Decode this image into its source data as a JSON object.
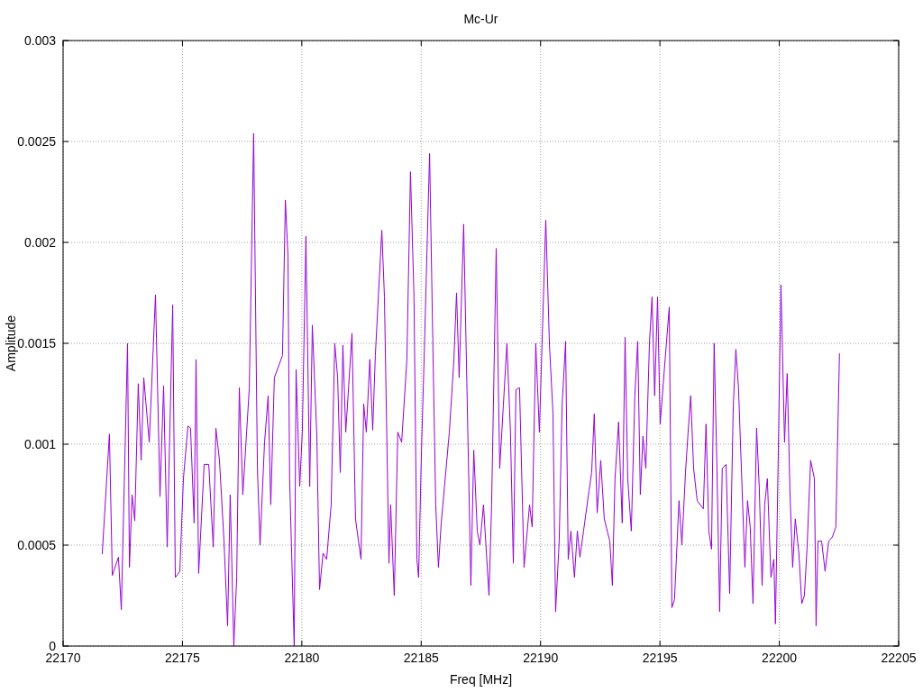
{
  "chart_data": {
    "type": "line",
    "grid": true,
    "title": "Mc-Ur",
    "xlabel": "Freq [MHz]",
    "ylabel": "Amplitude",
    "xlim": [
      22170,
      22205
    ],
    "ylim": [
      0,
      0.003
    ],
    "xticks": [
      22170,
      22175,
      22180,
      22185,
      22190,
      22195,
      22200,
      22205
    ],
    "yticks": [
      0,
      0.0005,
      0.001,
      0.0015,
      0.002,
      0.0025,
      0.003
    ],
    "x": [
      22171.64,
      22171.94,
      22172.06,
      22172.32,
      22172.44,
      22172.7,
      22172.78,
      22172.89,
      22173,
      22173.15,
      22173.27,
      22173.38,
      22173.61,
      22173.87,
      22174.06,
      22174.21,
      22174.36,
      22174.59,
      22174.7,
      22174.89,
      22175.04,
      22175.23,
      22175.34,
      22175.49,
      22175.57,
      22175.68,
      22175.91,
      22176.1,
      22176.29,
      22176.4,
      22176.55,
      22176.74,
      22176.89,
      22177,
      22177.15,
      22177.27,
      22177.38,
      22177.53,
      22177.8,
      22177.98,
      22178.14,
      22178.25,
      22178.44,
      22178.59,
      22178.7,
      22178.85,
      22179.19,
      22179.31,
      22179.42,
      22179.49,
      22179.68,
      22179.76,
      22179.91,
      22180.02,
      22180.17,
      22180.33,
      22180.44,
      22180.63,
      22180.74,
      22180.89,
      22181.04,
      22181.23,
      22181.38,
      22181.5,
      22181.61,
      22181.72,
      22181.84,
      22182.1,
      22182.25,
      22182.48,
      22182.59,
      22182.7,
      22182.85,
      22182.97,
      22183.08,
      22183.35,
      22183.46,
      22183.65,
      22183.72,
      22183.87,
      22184.02,
      22184.18,
      22184.4,
      22184.55,
      22184.7,
      22184.82,
      22184.89,
      22185.01,
      22185.12,
      22185.35,
      22185.5,
      22185.61,
      22185.72,
      22185.84,
      22186.18,
      22186.37,
      22186.48,
      22186.59,
      22186.78,
      22186.93,
      22187.08,
      22187.2,
      22187.35,
      22187.46,
      22187.61,
      22187.84,
      22187.95,
      22188.14,
      22188.29,
      22188.44,
      22188.59,
      22188.74,
      22188.86,
      22188.97,
      22189.12,
      22189.31,
      22189.54,
      22189.65,
      22189.8,
      22189.95,
      22190.22,
      22190.37,
      22190.52,
      22190.63,
      22190.78,
      22190.9,
      22191.05,
      22191.16,
      22191.27,
      22191.42,
      22191.54,
      22191.65,
      22191.8,
      22192.03,
      22192.14,
      22192.25,
      22192.37,
      22192.52,
      22192.67,
      22192.9,
      22193.01,
      22193.12,
      22193.27,
      22193.42,
      22193.54,
      22193.65,
      22193.8,
      22193.95,
      22194.07,
      22194.18,
      22194.29,
      22194.41,
      22194.56,
      22194.67,
      22194.78,
      22194.9,
      22195.01,
      22195.27,
      22195.39,
      22195.5,
      22195.61,
      22195.8,
      22195.92,
      22196.07,
      22196.18,
      22196.29,
      22196.41,
      22196.56,
      22196.82,
      22196.93,
      22197.05,
      22197.16,
      22197.27,
      22197.39,
      22197.5,
      22197.61,
      22197.77,
      22197.92,
      22198.07,
      22198.18,
      22198.29,
      22198.41,
      22198.56,
      22198.67,
      22198.78,
      22198.9,
      22199.05,
      22199.16,
      22199.28,
      22199.39,
      22199.5,
      22199.65,
      22199.77,
      22199.84,
      22199.96,
      22200.07,
      22200.22,
      22200.33,
      22200.45,
      22200.56,
      22200.67,
      22200.82,
      22200.94,
      22201.05,
      22201.16,
      22201.31,
      22201.47,
      22201.54,
      22201.62,
      22201.77,
      22201.92,
      22202.07,
      22202.22,
      22202.37,
      22202.52
    ],
    "series": [
      {
        "color": "#9400d3",
        "values": [
          0.000455,
          0.00105,
          0.00035,
          0.00044,
          0.00018,
          0.0015,
          0.00039,
          0.00075,
          0.00062,
          0.0013,
          0.00092,
          0.00133,
          0.00101,
          0.00174,
          0.00074,
          0.00129,
          0.00049,
          0.00169,
          0.00034,
          0.00037,
          0.00083,
          0.00109,
          0.00108,
          0.00061,
          0.00142,
          0.00036,
          0.0009,
          0.0009,
          0.00049,
          0.00108,
          0.00092,
          0.00052,
          0.0001,
          0.00075,
          0,
          0.00034,
          0.00128,
          0.00075,
          0.00128,
          0.00254,
          0.00088,
          0.0005,
          0.00101,
          0.00124,
          0.0007,
          0.00133,
          0.00144,
          0.00221,
          0.00193,
          0.00083,
          0,
          0.00137,
          0.00079,
          0.00106,
          0.00203,
          0.00079,
          0.00159,
          0.00104,
          0.00028,
          0.00046,
          0.00043,
          0.0007,
          0.0015,
          0.00133,
          0.00086,
          0.00149,
          0.00106,
          0.00155,
          0.00063,
          0.00043,
          0.0012,
          0.00106,
          0.00142,
          0.00107,
          0.00144,
          0.00206,
          0.00173,
          0.00041,
          0.0007,
          0.00025,
          0.00106,
          0.00101,
          0.00142,
          0.00235,
          0.00173,
          0.00043,
          0.00034,
          0.00097,
          0.00142,
          0.00244,
          0.00142,
          0.0007,
          0.00039,
          0.00061,
          0.00106,
          0.00142,
          0.00175,
          0.00133,
          0.00209,
          0.0012,
          0.0003,
          0.00097,
          0.00057,
          0.0005,
          0.0007,
          0.00025,
          0.0007,
          0.00197,
          0.00088,
          0.00119,
          0.0015,
          0.00106,
          0.00041,
          0.00127,
          0.00128,
          0.00039,
          0.0007,
          0.00059,
          0.0015,
          0.00106,
          0.00211,
          0.0015,
          0.00115,
          0.00017,
          0.00052,
          0.00119,
          0.00151,
          0.00043,
          0.00057,
          0.00034,
          0.00057,
          0.00044,
          0.00057,
          0.00077,
          0.00086,
          0.00115,
          0.00066,
          0.00092,
          0.00063,
          0.00052,
          0.0003,
          0.00083,
          0.00111,
          0.00061,
          0.00153,
          0.00083,
          0.00057,
          0.00124,
          0.00151,
          0.00075,
          0.00104,
          0.00088,
          0.0015,
          0.00173,
          0.00124,
          0.00173,
          0.0011,
          0.0015,
          0.00168,
          0.00019,
          0.00023,
          0.00072,
          0.0005,
          0.00086,
          0.00106,
          0.00124,
          0.00088,
          0.00072,
          0.00068,
          0.0011,
          0.00057,
          0.00048,
          0.0015,
          0.00088,
          0.00017,
          0.00088,
          0.0009,
          0.00026,
          0.00119,
          0.00147,
          0.00128,
          0.00088,
          0.00039,
          0.00072,
          0.00059,
          0.00021,
          0.00108,
          0.00079,
          0.0003,
          0.0007,
          0.00083,
          0.00034,
          0.00043,
          0.00011,
          0.00097,
          0.00179,
          0.00101,
          0.00135,
          0.00075,
          0.00039,
          0.00063,
          0.00046,
          0.00021,
          0.00025,
          0.00048,
          0.00092,
          0.00083,
          0.0001,
          0.00052,
          0.00052,
          0.00037,
          0.00052,
          0.00054,
          0.00059,
          0.00145
        ]
      }
    ]
  }
}
